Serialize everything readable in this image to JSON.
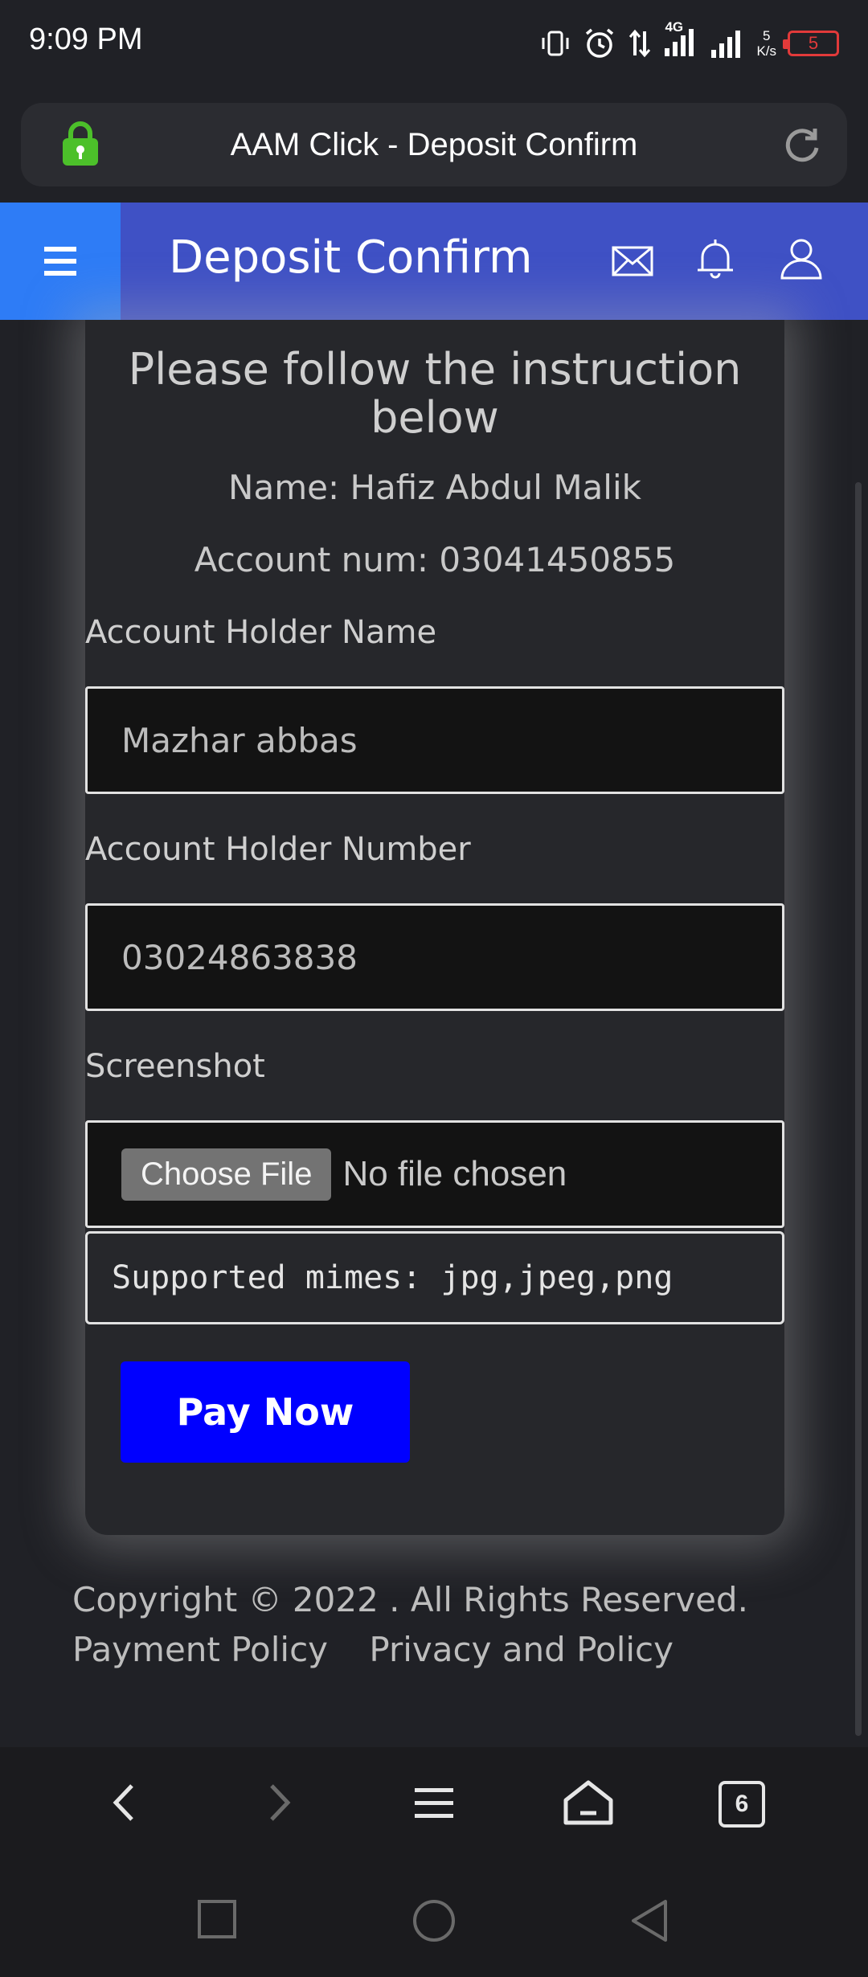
{
  "status_bar": {
    "time": "9:09 PM",
    "network_type": "4G",
    "speed_value": "5",
    "speed_unit": "K/s",
    "battery_level": "5"
  },
  "browser": {
    "page_title": "AAM Click - Deposit Confirm"
  },
  "header": {
    "title": "Deposit Confirm"
  },
  "card": {
    "instruction": "Please follow the instruction below",
    "name_line": "Name: Hafiz Abdul Malik",
    "account_line": "Account num: 03041450855",
    "holder_name_label": "Account Holder Name",
    "holder_name_value": "Mazhar abbas",
    "holder_number_label": "Account Holder Number",
    "holder_number_value": "03024863838",
    "screenshot_label": "Screenshot",
    "choose_file_label": "Choose File",
    "no_file_text": "No file chosen",
    "supported_mimes": "Supported mimes: jpg,jpeg,png",
    "pay_button": "Pay Now"
  },
  "footer": {
    "copyright": "Copyright © 2022 . All Rights Reserved.",
    "payment_policy": "Payment Policy",
    "privacy_policy": "Privacy and Policy"
  },
  "nav": {
    "tab_count": "6"
  },
  "colors": {
    "header_bg": "#3f51c5",
    "menu_bg": "#2e7cf6",
    "pay_button_bg": "#0000ff",
    "lock_green": "#4cc02a"
  },
  "icons": [
    "vibrate-icon",
    "alarm-icon",
    "data-arrows-icon",
    "signal-icon",
    "battery-icon",
    "lock-icon",
    "reload-icon",
    "menu-icon",
    "mail-icon",
    "bell-icon",
    "user-icon",
    "back-icon",
    "forward-icon",
    "tabs-menu-icon",
    "home-icon",
    "recents-icon",
    "home-circle-icon",
    "back-triangle-icon"
  ]
}
